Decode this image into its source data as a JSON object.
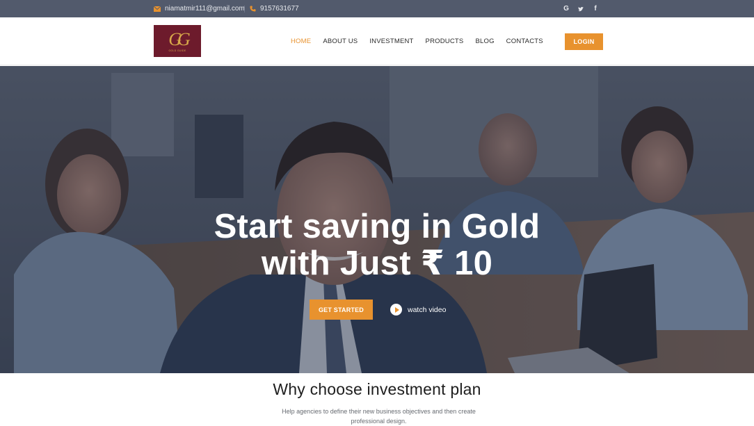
{
  "topbar": {
    "email": "niamatmir111@gmail.com",
    "phone": "9157631677",
    "social": [
      {
        "icon": "google-icon",
        "label": "G"
      },
      {
        "icon": "twitter-icon",
        "label": "🐦"
      },
      {
        "icon": "facebook-icon",
        "label": "f"
      }
    ]
  },
  "header": {
    "logo": {
      "mark": "GG",
      "sub": "GOLD GUIDE"
    },
    "nav": [
      "HOME",
      "ABOUT US",
      "INVESTMENT",
      "PRODUCTS",
      "BLOG",
      "CONTACTS"
    ],
    "active_nav": "HOME",
    "login": "LOGIN"
  },
  "hero": {
    "title_line1": "Start saving in Gold",
    "title_line2": "with Just ₹ 10",
    "cta": "GET STARTED",
    "watch": "watch video"
  },
  "section": {
    "title": "Why choose investment plan",
    "subtitle": "Help agencies to define their new business objectives and then create professional design."
  },
  "colors": {
    "accent": "#e8922e",
    "topbar_bg": "#525a6c",
    "logo_bg": "#6d1b2c"
  }
}
